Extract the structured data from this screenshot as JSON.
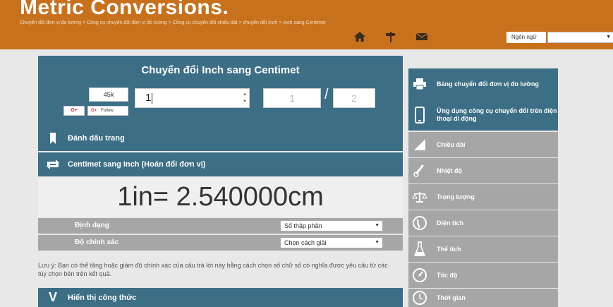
{
  "header": {
    "site_title": "Metric Conversions.",
    "breadcrumb": "Chuyển đổi đơn vị đo lường > Công cụ chuyển đổi đơn vị đo lường > Công cụ chuyển đổi chiều dài > chuyển đổi Inch > Inch sang Centimet",
    "icons": [
      "home-icon",
      "signpost-icon",
      "mail-icon"
    ],
    "language_label": "Ngôn ngữ",
    "language_value": ""
  },
  "converter": {
    "title": "Chuyển đổi Inch sang Centimet",
    "share_count": "45k",
    "gplus_label": "G+",
    "follow_label": "Follow",
    "input_value": "1",
    "fraction_numerator_placeholder": "1",
    "fraction_separator": "/",
    "fraction_denominator_placeholder": "2"
  },
  "actions": {
    "bookmark_label": "Đánh dấu trang",
    "swap_label": "Centimet sang Inch (Hoán đổi đơn vị)"
  },
  "result": {
    "text": "1in= 2.540000cm"
  },
  "options": {
    "format_label": "Định dạng",
    "format_value": "Số thập phân",
    "precision_label": "Độ chính xác",
    "precision_value": "Chọn cách giải"
  },
  "note": "Lưu ý: Bạn có thể tăng hoặc giảm độ chính xác của câu trả lời này bằng cách chọn số chữ số có nghĩa được yêu cầu từ các tùy chọn bên trên kết quả.",
  "formula_bar": {
    "icon_text": "V",
    "label": "Hiển thị công thức"
  },
  "sidebar": {
    "items": [
      {
        "label": "Bảng chuyển đổi đơn vị đo lường",
        "icon": "printer-icon"
      },
      {
        "label": "Ứng dụng công cụ chuyển đổi trên điện thoại di động",
        "icon": "phone-icon"
      },
      {
        "label": "Chiều dài",
        "icon": "ruler-icon"
      },
      {
        "label": "Nhiệt độ",
        "icon": "thermometer-icon"
      },
      {
        "label": "Trọng lượng",
        "icon": "scale-icon"
      },
      {
        "label": "Diện tích",
        "icon": "globe-icon"
      },
      {
        "label": "Thể tích",
        "icon": "flask-icon"
      },
      {
        "label": "Tốc độ",
        "icon": "speedometer-icon"
      },
      {
        "label": "Thời gian",
        "icon": "clock-icon"
      }
    ]
  },
  "colors": {
    "header": "#c8711d",
    "panel": "#3c6e85",
    "grey": "#a6a6a6"
  }
}
